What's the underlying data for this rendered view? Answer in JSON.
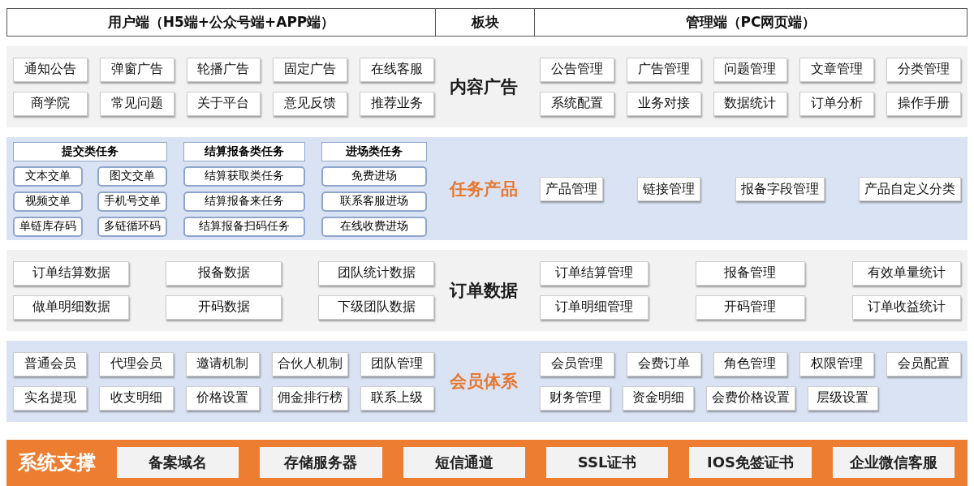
{
  "header": [
    "用户端（H5端+公众号端+APP端）",
    "板块",
    "管理端（PC网页端）"
  ],
  "sections": [
    {
      "kind": "grid",
      "color": "#f2f2f2",
      "label": {
        "text": "内容广告",
        "color": "#1a1a1a"
      },
      "user": [
        [
          "通知公告",
          "弹窗广告",
          "轮播广告",
          "固定广告",
          "在线客服"
        ],
        [
          "商学院",
          "常见问题",
          "关于平台",
          "意见反馈",
          "推荐业务"
        ]
      ],
      "admin": [
        [
          "公告管理",
          "广告管理",
          "问题管理",
          "文章管理",
          "分类管理"
        ],
        [
          "系统配置",
          "业务对接",
          "数据统计",
          "订单分析",
          "操作手册"
        ]
      ]
    },
    {
      "kind": "tasks",
      "color": "#dae3f3",
      "label": {
        "text": "任务产品",
        "color": "#e8772e"
      },
      "groups": [
        {
          "title": "提交类任务",
          "items": [
            "文本交单",
            "图文交单",
            "视频交单",
            "手机号交单",
            "单链库存码",
            "多链循环码"
          ]
        },
        {
          "title": "结算报备类任务",
          "items": [
            "结算获取类任务",
            "结算报备来任务",
            "结算报备扫码任务"
          ]
        },
        {
          "title": "进场类任务",
          "items": [
            "免费进场",
            "联系客服进场",
            "在线收费进场"
          ]
        }
      ],
      "admin": [
        [
          "产品管理",
          "链接管理",
          "报备字段管理",
          "产品自定义分类"
        ]
      ]
    },
    {
      "kind": "grid",
      "color": "#f2f2f2",
      "label": {
        "text": "订单数据",
        "color": "#1a1a1a"
      },
      "user": [
        [
          "订单结算数据",
          "报备数据",
          "团队统计数据"
        ],
        [
          "做单明细数据",
          "开码数据",
          "下级团队数据"
        ]
      ],
      "admin": [
        [
          "订单结算管理",
          "报备管理",
          "有效单量统计"
        ],
        [
          "订单明细管理",
          "开码管理",
          "订单收益统计"
        ]
      ]
    },
    {
      "kind": "grid",
      "color": "#dae3f3",
      "label": {
        "text": "会员体系",
        "color": "#e8772e"
      },
      "user": [
        [
          "普通会员",
          "代理会员",
          "邀请机制",
          "合伙人机制",
          "团队管理"
        ],
        [
          "实名提现",
          "收支明细",
          "价格设置",
          "佣金排行榜",
          "联系上级"
        ]
      ],
      "admin": [
        [
          "会员管理",
          "会费订单",
          "角色管理",
          "权限管理",
          "会员配置"
        ],
        [
          "财务管理",
          "资金明细",
          "会费价格设置",
          "层级设置"
        ]
      ]
    }
  ],
  "support": {
    "title": "系统支撑",
    "items": [
      "备案域名",
      "存储服务器",
      "短信通道",
      "SSL证书",
      "IOS免签证书",
      "企业微信客服"
    ]
  }
}
